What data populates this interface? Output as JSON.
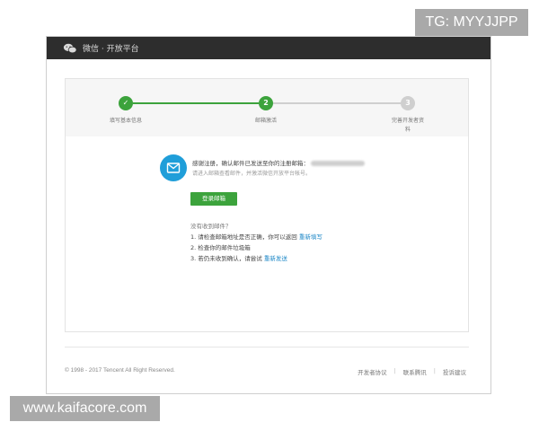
{
  "watermarks": {
    "tg": "TG: MYYJJPP",
    "site": "www.kaifacore.com"
  },
  "header": {
    "title": "微信 · 开放平台",
    "logo_icon": "wechat-logo-icon"
  },
  "steps": [
    {
      "number": "✓",
      "label": "填写基本信息",
      "state": "done"
    },
    {
      "number": "2",
      "label": "邮箱激活",
      "state": "active"
    },
    {
      "number": "3",
      "label": "完善开发者资料",
      "state": "pending"
    }
  ],
  "colors": {
    "accent": "#3ca33c",
    "mail": "#1f9ed9",
    "link": "#1e88c7",
    "inactive": "#cfcfcf"
  },
  "confirm": {
    "mail_icon": "mail-icon",
    "title": "感谢注册，确认邮件已发送至你的注册邮箱：",
    "hint": "请进入邮箱查看邮件，并激活微信开放平台帐号。",
    "login_button": "登录邮箱"
  },
  "help": {
    "no_email": "没有收到邮件？",
    "tip1_text": "1. 请检查邮箱地址是否正确，你可以返回",
    "tip1_link": "重新填写",
    "tip2_text": "2. 检查你的邮件垃圾箱",
    "tip3_text": "3. 若仍未收到确认，请尝试",
    "tip3_link": "重新发送"
  },
  "footer": {
    "copyright": "© 1998 - 2017 Tencent All Right Reserved.",
    "links": [
      "开发者协议",
      "联系腾讯",
      "投诉建议"
    ],
    "separator": "|"
  }
}
